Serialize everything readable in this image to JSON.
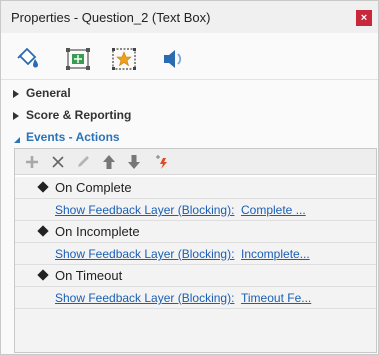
{
  "window": {
    "title": "Properties - Question_2 (Text Box)",
    "close_glyph": "×"
  },
  "tool_icons": [
    "paint-bucket-icon",
    "size-position-icon",
    "star-effect-icon",
    "audio-icon"
  ],
  "sections": [
    {
      "label": "General",
      "expanded": false
    },
    {
      "label": "Score & Reporting",
      "expanded": false
    },
    {
      "label": "Events - Actions",
      "expanded": true
    }
  ],
  "actions_toolbar": [
    "add-icon",
    "delete-icon",
    "edit-icon",
    "move-up-icon",
    "move-down-icon",
    "trigger-icon"
  ],
  "events": [
    {
      "event": "On Complete",
      "action": "Show Feedback Layer (Blocking):",
      "target": "Complete ..."
    },
    {
      "event": "On Incomplete",
      "action": "Show Feedback Layer (Blocking):",
      "target": "Incomplete..."
    },
    {
      "event": "On Timeout",
      "action": "Show Feedback Layer (Blocking):",
      "target": "Timeout Fe..."
    }
  ],
  "colors": {
    "accent": "#2a74b8",
    "link": "#1a5fb4",
    "close_button": "#c8283c"
  }
}
